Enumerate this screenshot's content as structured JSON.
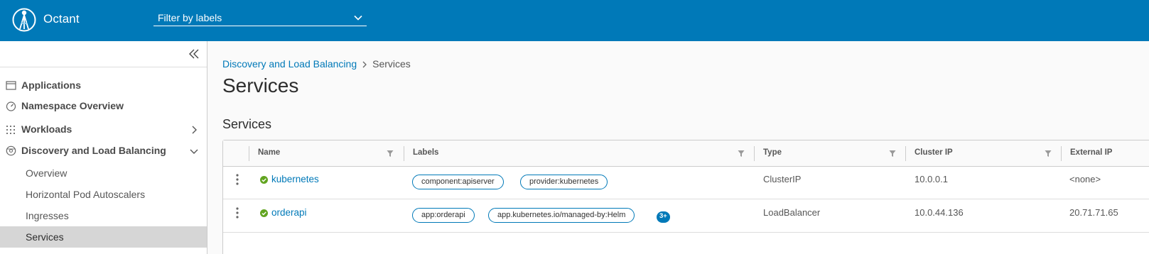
{
  "header": {
    "app_title": "Octant",
    "filter_placeholder": "Filter by labels"
  },
  "sidebar": {
    "items": [
      {
        "label": "Applications",
        "icon": "applications-icon"
      },
      {
        "label": "Namespace Overview",
        "icon": "dashboard-icon"
      },
      {
        "label": "Workloads",
        "icon": "grid-icon"
      },
      {
        "label": "Discovery and Load Balancing",
        "icon": "network-globe-icon"
      }
    ],
    "sub_items": [
      {
        "label": "Overview"
      },
      {
        "label": "Horizontal Pod Autoscalers"
      },
      {
        "label": "Ingresses"
      },
      {
        "label": "Services"
      }
    ]
  },
  "main": {
    "breadcrumb": {
      "parent": "Discovery and Load Balancing",
      "current": "Services"
    },
    "page_title": "Services",
    "section_title": "Services",
    "table": {
      "columns": [
        "Name",
        "Labels",
        "Type",
        "Cluster IP",
        "External IP"
      ],
      "rows": [
        {
          "name": "kubernetes",
          "labels": [
            "component:apiserver",
            "provider:kubernetes"
          ],
          "more": "",
          "type": "ClusterIP",
          "cluster_ip": "10.0.0.1",
          "external_ip": "<none>"
        },
        {
          "name": "orderapi",
          "labels": [
            "app:orderapi",
            "app.kubernetes.io/managed-by:Helm"
          ],
          "more": "3+",
          "type": "LoadBalancer",
          "cluster_ip": "10.0.44.136",
          "external_ip": "20.71.71.65"
        }
      ]
    }
  },
  "colors": {
    "header_bg": "#0079b8",
    "link": "#0079b8",
    "status_ok": "#62a420",
    "active_nav_bg": "#d6d6d6"
  }
}
